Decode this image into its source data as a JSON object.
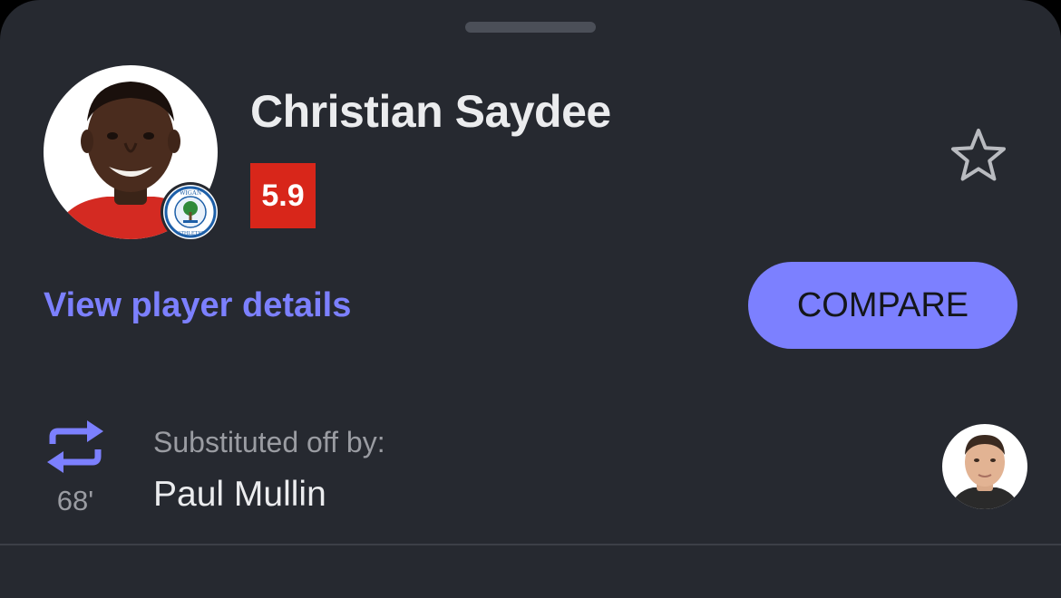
{
  "player": {
    "name": "Christian Saydee",
    "rating": "5.9",
    "rating_color": "#d8261a",
    "club_badge": "wigan-athletic-badge",
    "club_badge_text_top": "WIGAN",
    "club_badge_text_bottom": "ATHLETIC"
  },
  "actions": {
    "favorite_icon": "star-outline-icon",
    "details_link": "View player details",
    "compare_label": "COMPARE",
    "accent_color": "#7c80ff"
  },
  "substitution": {
    "icon": "swap-arrows-icon",
    "minute": "68'",
    "caption": "Substituted off by:",
    "player_name": "Paul Mullin"
  }
}
